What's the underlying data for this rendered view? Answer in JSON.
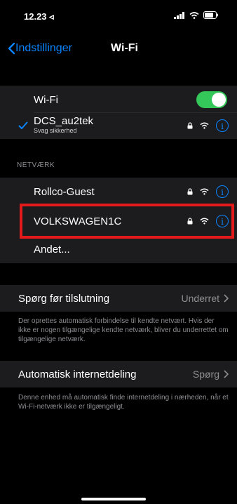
{
  "status_bar": {
    "time": "12.23 ◃"
  },
  "nav": {
    "back_label": "Indstillinger",
    "title": "Wi-Fi"
  },
  "wifi": {
    "label": "Wi-Fi",
    "enabled": true
  },
  "connected_network": {
    "name": "DCS_au2tek",
    "subtitle": "Svag sikkerhed"
  },
  "networks_section": {
    "header": "NETVÆRK"
  },
  "networks": [
    {
      "name": "Rollco-Guest"
    },
    {
      "name": "VOLKSWAGEN1C"
    },
    {
      "name": "Andet..."
    }
  ],
  "ask_to_join": {
    "label": "Spørg før tilslutning",
    "value": "Underret",
    "footer": "Der oprettes automatisk forbindelse til kendte netvært. Hvis der ikke er nogen tilgængelige kendte netværk, bliver du underrettet om tilgængelige netværk."
  },
  "auto_hotspot": {
    "label": "Automatisk internetdeling",
    "value": "Spørg",
    "footer": "Denne enhed må automatisk finde internetdeling i nærheden, når et Wi-Fi-netværk ikke er tilgængeligt."
  },
  "colors": {
    "accent": "#0a84ff",
    "toggle_on": "#34c759",
    "highlight": "#e21a1a"
  }
}
